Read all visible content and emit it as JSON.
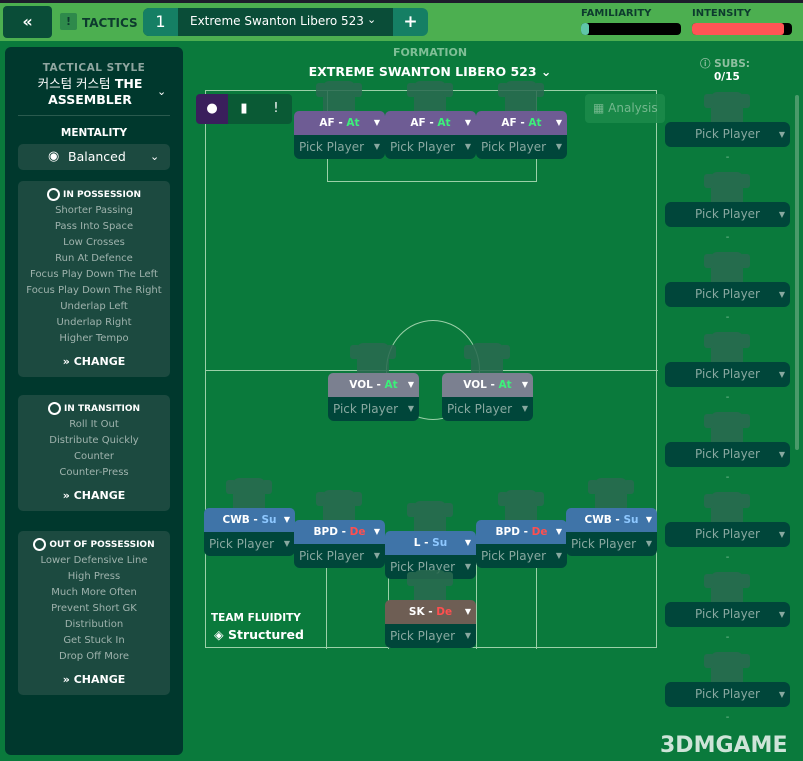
{
  "header": {
    "back_icon": "double-chevron-left",
    "tactics_label": "TACTICS",
    "tactic_slot": "1",
    "tactic_name": "Extreme Swanton Libero 523",
    "add_label": "+",
    "familiarity_label": "FAMILIARITY",
    "familiarity_level": 0.08,
    "intensity_label": "INTENSITY",
    "intensity_level": 0.92,
    "intensity_color": "#ff5555",
    "familiarity_color": "#5fc6a8"
  },
  "left": {
    "tactical_style_label": "TACTICAL STYLE",
    "tactical_style_ko": "커스텀 커스텀",
    "tactical_style_name": "THE ASSEMBLER",
    "mentality_label": "MENTALITY",
    "mentality_value": "Balanced",
    "cards": [
      {
        "title": "IN POSSESSION",
        "items": [
          "Shorter Passing",
          "Pass Into Space",
          "Low Crosses",
          "Run At Defence",
          "Focus Play Down The Left",
          "Focus Play Down The Right",
          "Underlap Left",
          "Underlap Right",
          "Higher Tempo"
        ],
        "change": "CHANGE"
      },
      {
        "title": "IN TRANSITION",
        "items": [
          "Roll It Out",
          "Distribute Quickly",
          "Counter",
          "Counter-Press"
        ],
        "change": "CHANGE"
      },
      {
        "title": "OUT OF POSSESSION",
        "items": [
          "Lower Defensive Line",
          "High Press",
          "Much More Often",
          "Prevent Short GK",
          "Distribution",
          "Get Stuck In",
          "Drop Off More"
        ],
        "change": "CHANGE"
      }
    ]
  },
  "formation": {
    "label": "FORMATION",
    "name": "EXTREME SWANTON LIBERO 523"
  },
  "analysis_label": "Analysis",
  "players": [
    {
      "role": "AF",
      "duty": "At",
      "pick": "Pick Player",
      "group": "attack"
    },
    {
      "role": "AF",
      "duty": "At",
      "pick": "Pick Player",
      "group": "attack"
    },
    {
      "role": "AF",
      "duty": "At",
      "pick": "Pick Player",
      "group": "attack"
    },
    {
      "role": "VOL",
      "duty": "At",
      "pick": "Pick Player",
      "group": "midfield"
    },
    {
      "role": "VOL",
      "duty": "At",
      "pick": "Pick Player",
      "group": "midfield"
    },
    {
      "role": "CWB",
      "duty": "Su",
      "pick": "Pick Player",
      "group": "defence"
    },
    {
      "role": "BPD",
      "duty": "De",
      "pick": "Pick Player",
      "group": "defence"
    },
    {
      "role": "L",
      "duty": "Su",
      "pick": "Pick Player",
      "group": "defence"
    },
    {
      "role": "BPD",
      "duty": "De",
      "pick": "Pick Player",
      "group": "defence"
    },
    {
      "role": "CWB",
      "duty": "Su",
      "pick": "Pick Player",
      "group": "defence"
    },
    {
      "role": "SK",
      "duty": "De",
      "pick": "Pick Player",
      "group": "goalkeeper"
    }
  ],
  "colors": {
    "attack": "#6e5c94",
    "midfield": "#7b8090",
    "defence": "#3f74a8",
    "goalkeeper": "#6e5e54",
    "At": "#3cf07a",
    "Su": "#8ec8ff",
    "De": "#ff4f4f"
  },
  "fluidity": {
    "label": "TEAM FLUIDITY",
    "value": "Structured"
  },
  "subs": {
    "label": "SUBS:",
    "count": "0/15",
    "items": [
      "Pick Player",
      "Pick Player",
      "Pick Player",
      "Pick Player",
      "Pick Player",
      "Pick Player",
      "Pick Player",
      "Pick Player"
    ],
    "empty": "-"
  },
  "watermark": "3DMGAME"
}
